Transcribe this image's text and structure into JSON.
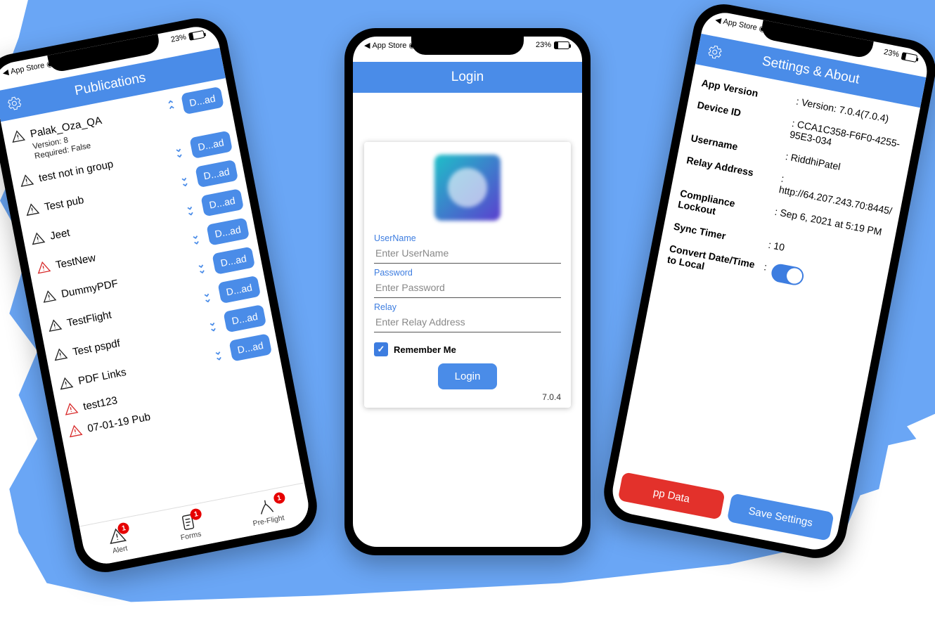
{
  "status": {
    "battery": "23%",
    "back": "App Store"
  },
  "publications": {
    "title": "Publications",
    "download_label": "D...ad",
    "first": {
      "name": "Palak_Oza_QA",
      "version_line": "Version: 8",
      "required_line": "Required: False"
    },
    "items": [
      {
        "name": "test not in group",
        "red": false
      },
      {
        "name": "Test pub",
        "red": false
      },
      {
        "name": "Jeet",
        "red": false
      },
      {
        "name": "TestNew",
        "red": true
      },
      {
        "name": "DummyPDF",
        "red": false
      },
      {
        "name": "TestFlight",
        "red": false
      },
      {
        "name": "Test pspdf",
        "red": false
      },
      {
        "name": "PDF Links",
        "red": false
      },
      {
        "name": "test123",
        "red": true
      },
      {
        "name": "07-01-19 Pub",
        "red": true
      }
    ],
    "tabs": {
      "alert": "Alert",
      "forms": "Forms",
      "preflight": "Pre-Flight",
      "badge": "1"
    }
  },
  "login": {
    "title": "Login",
    "username_label": "UserName",
    "username_placeholder": "Enter UserName",
    "password_label": "Password",
    "password_placeholder": "Enter Password",
    "relay_label": "Relay",
    "relay_placeholder": "Enter Relay Address",
    "remember": "Remember Me",
    "button": "Login",
    "version": "7.0.4"
  },
  "settings": {
    "title": "Settings & About",
    "rows": {
      "app_version": {
        "k": "App Version",
        "v": "Version: 7.0.4(7.0.4)"
      },
      "device_id": {
        "k": "Device ID",
        "v": "CCA1C358-F6F0-4255-95E3-034"
      },
      "username": {
        "k": "Username",
        "v": "RiddhiPatel"
      },
      "relay": {
        "k": "Relay Address",
        "v": "http://64.207.243.70:8445/"
      },
      "lockout": {
        "k": "Compliance Lockout",
        "v": "Sep 6, 2021 at 5:19 PM"
      },
      "sync": {
        "k": "Sync Timer",
        "v": "10"
      },
      "convert": {
        "k": "Convert Date/Time to Local"
      }
    },
    "delete": "pp Data",
    "save": "Save Settings"
  }
}
